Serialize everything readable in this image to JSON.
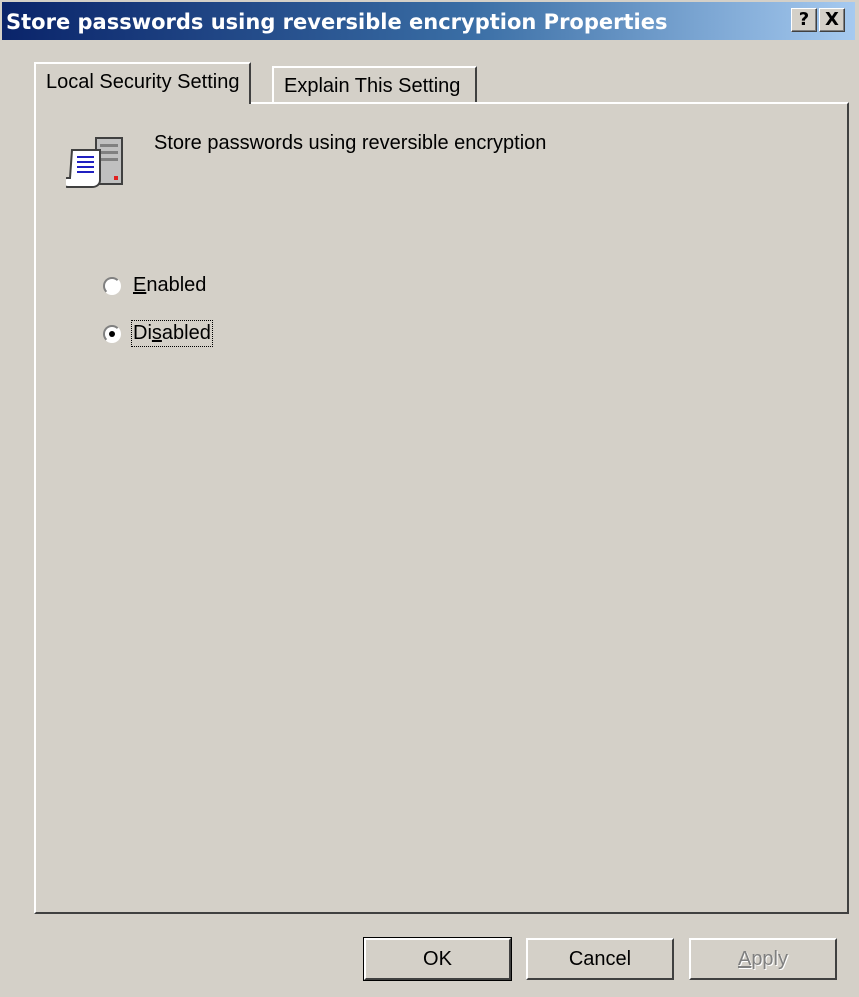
{
  "window": {
    "title": "Store passwords using reversible encryption Properties",
    "help_label": "?",
    "close_label": "X"
  },
  "tabs": [
    {
      "label": "Local Security Setting",
      "active": true
    },
    {
      "label": "Explain This Setting",
      "active": false
    }
  ],
  "policy": {
    "icon": "policy-server-scroll-icon",
    "name": "Store passwords using reversible encryption"
  },
  "options": [
    {
      "label": "Enabled",
      "accel_prefix": "",
      "accel_char": "E",
      "accel_suffix": "nabled",
      "selected": false
    },
    {
      "label": "Disabled",
      "accel_prefix": "Di",
      "accel_char": "s",
      "accel_suffix": "abled",
      "selected": true
    }
  ],
  "buttons": {
    "ok_label": "OK",
    "cancel_label": "Cancel",
    "apply_label": "Apply",
    "apply_accel_char": "A",
    "apply_accel_suffix": "pply"
  },
  "colors": {
    "titlebar_start": "#0a246a",
    "titlebar_end": "#a6caf0",
    "face": "#d4d0c8"
  }
}
